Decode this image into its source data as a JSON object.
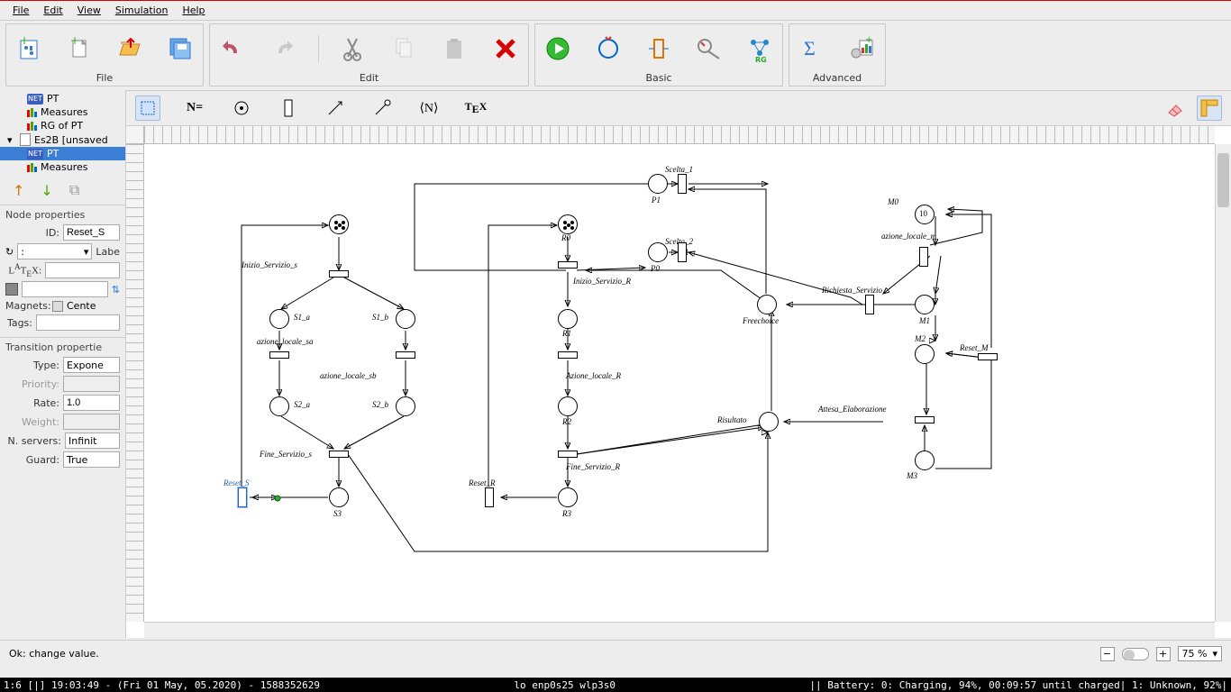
{
  "menu": {
    "file": "File",
    "edit": "Edit",
    "view": "View",
    "simulation": "Simulation",
    "help": "Help"
  },
  "toolbar_groups": {
    "file": "File",
    "edit": "Edit",
    "basic": "Basic",
    "advanced": "Advanced"
  },
  "sec_toolbar": {
    "neq": "N=",
    "nbrak": "⟨N⟩",
    "tex": "TEX"
  },
  "tree": {
    "pt": "PT",
    "measures": "Measures",
    "rg_of_pt": "RG of PT",
    "project": "Es2B [unsaved",
    "sel_pt": "PT",
    "measures2": "Measures"
  },
  "node_props": {
    "legend": "Node properties",
    "id_label": "ID:",
    "id_value": "Reset_S",
    "rot_value": ":",
    "label_lbl": "Labe",
    "latex_lbl": "LATEX:",
    "magnets_lbl": "Magnets:",
    "magnets_val": "Cente",
    "tags_lbl": "Tags:"
  },
  "trans_props": {
    "legend": "Transition propertie",
    "type_lbl": "Type:",
    "type_val": "Expone",
    "priority_lbl": "Priority:",
    "rate_lbl": "Rate:",
    "rate_val": "1.0",
    "weight_lbl": "Weight:",
    "nservers_lbl": "N. servers:",
    "nservers_val": "Infinit",
    "guard_lbl": "Guard:",
    "guard_val": "True"
  },
  "net_labels": {
    "scelta1": "Scelta_1",
    "p1": "P1",
    "scelta2": "Scelta_2",
    "p0": "P0",
    "inizio_s": "Inizio_Servizio_s",
    "s1a": "S1_a",
    "s1b": "S1_b",
    "azione_sa": "azione_locale_sa",
    "azione_sb": "azione_locale_sb",
    "s2a": "S2_a",
    "s2b": "S2_b",
    "fine_s": "Fine_Servizio_s",
    "reset_s": "Reset_S",
    "s3": "S3",
    "inizio_r": "Inizio_Servizio_R",
    "r1": "R1",
    "azione_r": "Azione_locale_R",
    "r2": "R2",
    "fine_r": "Fine_Servizio_R",
    "reset_r": "Reset_R",
    "r3": "R3",
    "r0": "R0",
    "m0": "M0",
    "ten": "10",
    "azione_m": "azione_locale_m",
    "m1": "M1",
    "richiesta": "Richiesta_Servizio",
    "freechoice": "Freechoice",
    "m2": "M2",
    "reset_m": "Reset_M",
    "attesa": "Attesa_Elaborazione",
    "risultato": "Risultato",
    "m3": "M3",
    "s0": ""
  },
  "status": {
    "msg": "Ok: change value.",
    "zoom": "75 %"
  },
  "sysbar": {
    "left": "1:6 [|]    19:03:49 - (Fri 01 May, 05.2020) - 1588352629",
    "center": "lo enp0s25 wlp3s0",
    "right": "||  Battery: 0: Charging, 94%, 00:09:57 until charged| 1: Unknown, 92%|"
  }
}
